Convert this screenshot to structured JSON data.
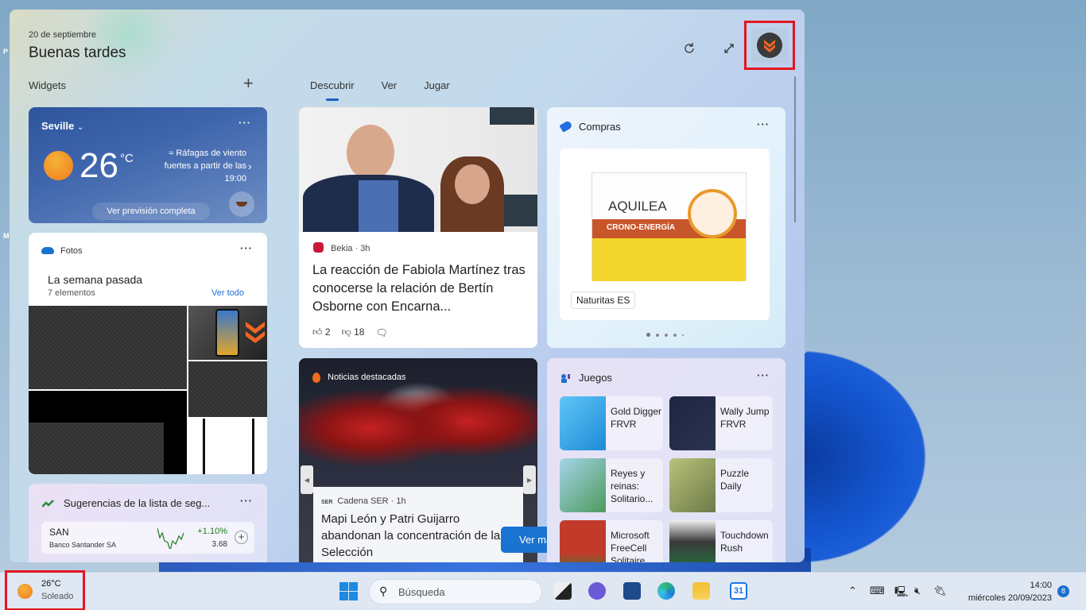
{
  "panel": {
    "date": "20 de septiembre",
    "greeting": "Buenas tardes",
    "widgets_label": "Widgets",
    "add_widget_icon": "plus-icon",
    "refresh_icon": "refresh-icon",
    "expand_icon": "expand-icon",
    "tabs": [
      {
        "label": "Descubrir",
        "active": true
      },
      {
        "label": "Ver",
        "active": false
      },
      {
        "label": "Jugar",
        "active": false
      }
    ]
  },
  "weather": {
    "city": "Seville",
    "temperature": "26",
    "unit": "°C",
    "alert": "Ráfagas de viento fuertes a partir de las 19:00",
    "cta": "Ver previsión completa",
    "more": "···"
  },
  "photos": {
    "label": "Fotos",
    "title": "La semana pasada",
    "count": "7 elementos",
    "see_all": "Ver todo",
    "more": "···"
  },
  "stocks": {
    "title": "Sugerencias de la lista de seg...",
    "more": "···",
    "items": [
      {
        "symbol": "SAN",
        "name": "Banco Santander SA",
        "change": "+1.10%",
        "price": "3.68",
        "color": "#1e7a1e"
      }
    ]
  },
  "news": [
    {
      "source": "Bekia · 3h",
      "title": "La reacción de Fabiola Martínez tras conocerse la relación de Bertín Osborne con Encarna...",
      "likes": "2",
      "dislikes": "18"
    },
    {
      "section": "Noticias destacadas",
      "source": "Cadena SER · 1h",
      "title": "Mapi León y Patri Guijarro abandonan la concentración de la Selección"
    }
  ],
  "see_more": "Ver más",
  "shopping": {
    "title": "Compras",
    "more": "···",
    "product_brand": "AQUILEA",
    "product_line": "CRONO-ENERGÍA",
    "store": "Naturitas ES",
    "pages": 5,
    "current_page": 1
  },
  "games": {
    "title": "Juegos",
    "more": "···",
    "items": [
      {
        "name": "Gold Digger FRVR",
        "color": "#2a9fe0"
      },
      {
        "name": "Wally Jump FRVR",
        "color": "#1d2540"
      },
      {
        "name": "Reyes y reinas: Solitario...",
        "color": "#4d9a5c"
      },
      {
        "name": "Puzzle Daily",
        "color": "#8e9a6a"
      },
      {
        "name": "Microsoft FreeCell Solitaire",
        "color": "#c23b2a"
      },
      {
        "name": "Touchdown Rush",
        "color": "#3a3a3a"
      }
    ]
  },
  "taskbar": {
    "weather_temp": "26°C",
    "weather_cond": "Soleado",
    "search_placeholder": "Búsqueda",
    "time": "14:00",
    "date": "miércoles 20/09/2023",
    "notifications": "8",
    "accent": "#1a6fd0"
  }
}
